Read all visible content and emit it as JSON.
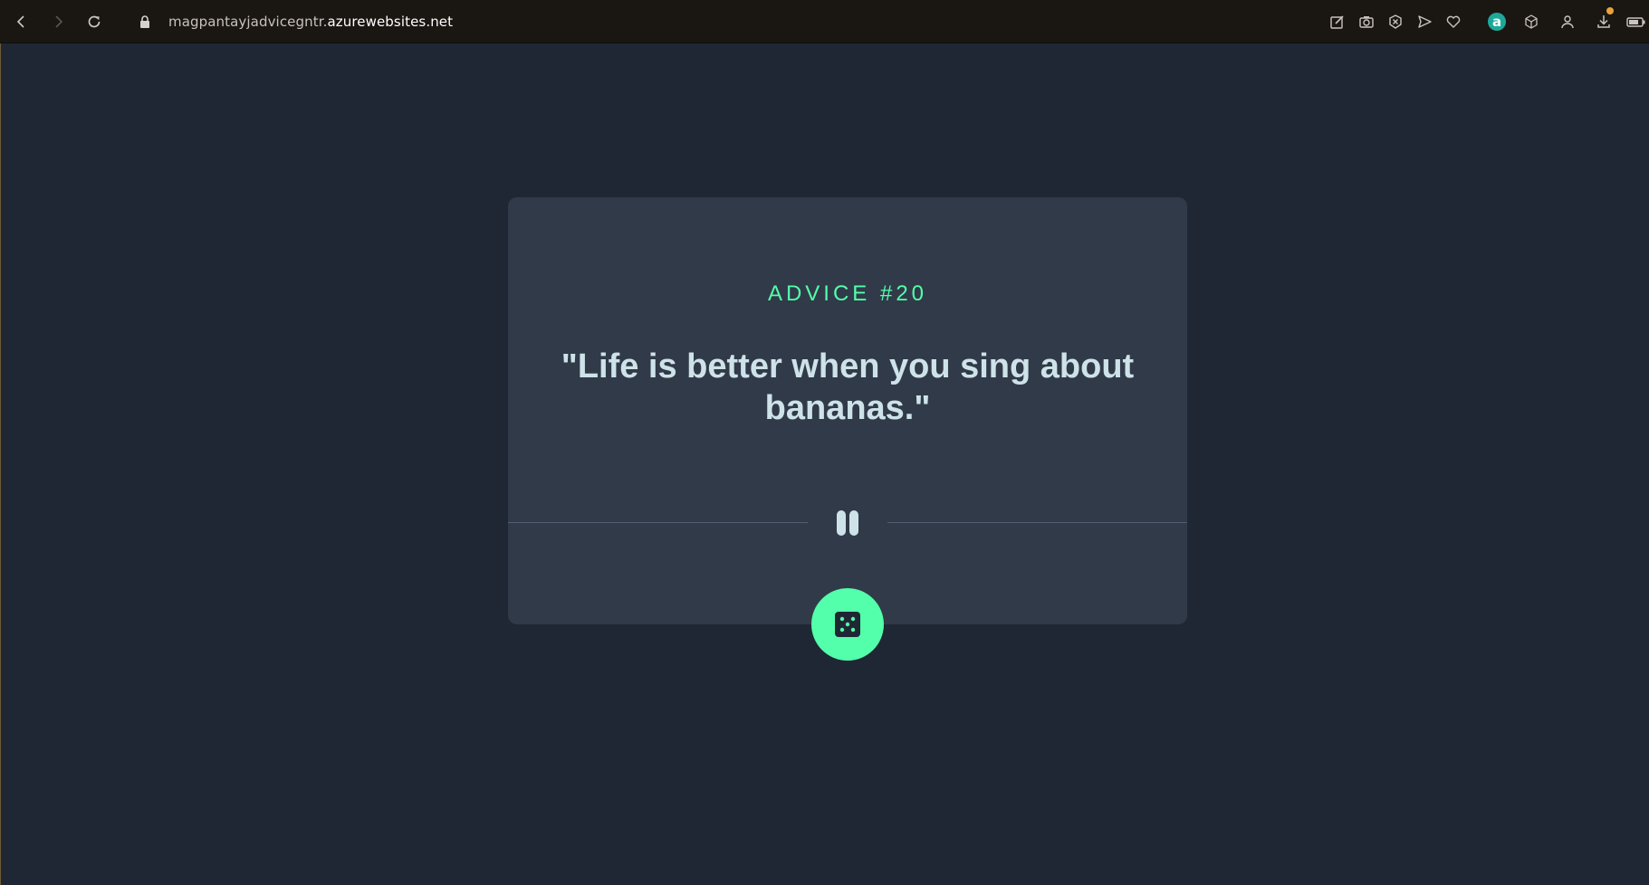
{
  "browser": {
    "url_prefix": "magpantayjadvicegntr.",
    "url_domain": "azurewebsites.net",
    "extension_letter": "a"
  },
  "advice": {
    "label": "ADVICE #20",
    "quote": "\"Life is better when you sing about bananas.\""
  },
  "icons": {
    "back": "back-arrow-icon",
    "forward": "forward-arrow-icon",
    "reload": "reload-icon",
    "lock": "lock-icon",
    "dice": "dice-icon"
  },
  "colors": {
    "page_bg": "#202734",
    "card_bg": "#313a49",
    "accent": "#53ffaa",
    "text": "#cee3e9",
    "divider": "#4f5d74"
  }
}
